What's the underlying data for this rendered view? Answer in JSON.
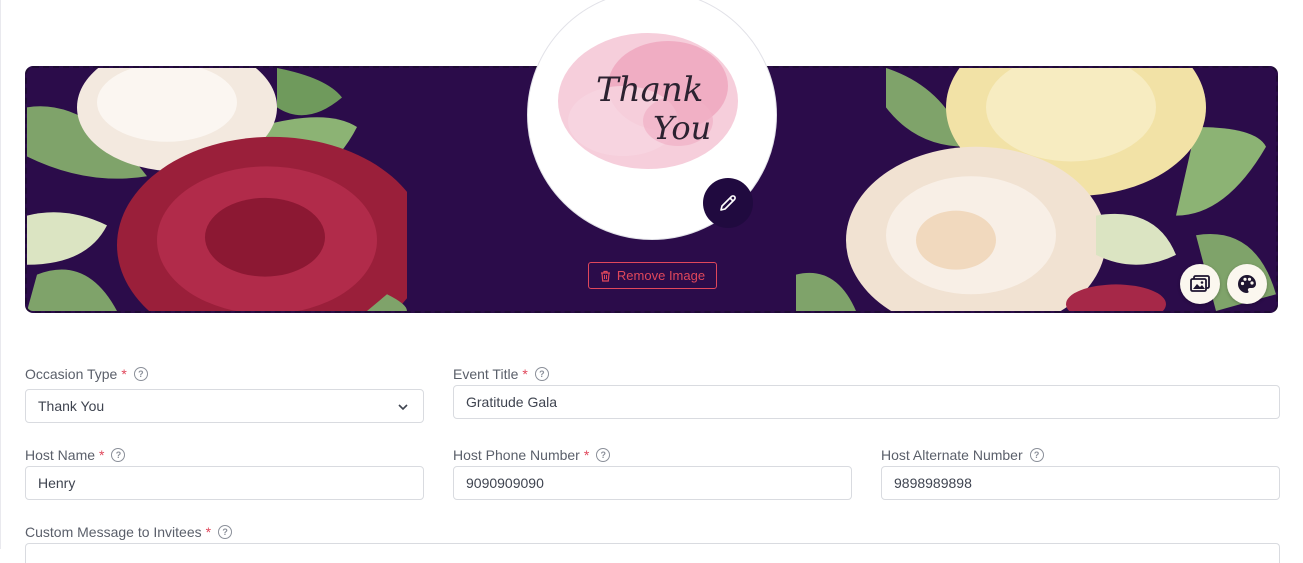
{
  "banner": {
    "remove_image_label": "Remove Image",
    "avatar_text_line1": "Thank",
    "avatar_text_line2": "You",
    "background_color": "#2b0c4a",
    "accent_color": "#200a3f",
    "remove_color": "#e0475b"
  },
  "form": {
    "occasion_type": {
      "label": "Occasion Type",
      "value": "Thank You"
    },
    "event_title": {
      "label": "Event Title",
      "value": "Gratitude Gala"
    },
    "host_name": {
      "label": "Host Name",
      "value": "Henry"
    },
    "host_phone": {
      "label": "Host Phone Number",
      "value": "9090909090"
    },
    "host_alt_phone": {
      "label": "Host Alternate Number",
      "value": "9898989898"
    },
    "custom_message": {
      "label": "Custom Message to Invitees"
    },
    "required_mark": "*",
    "help_glyph": "?"
  }
}
